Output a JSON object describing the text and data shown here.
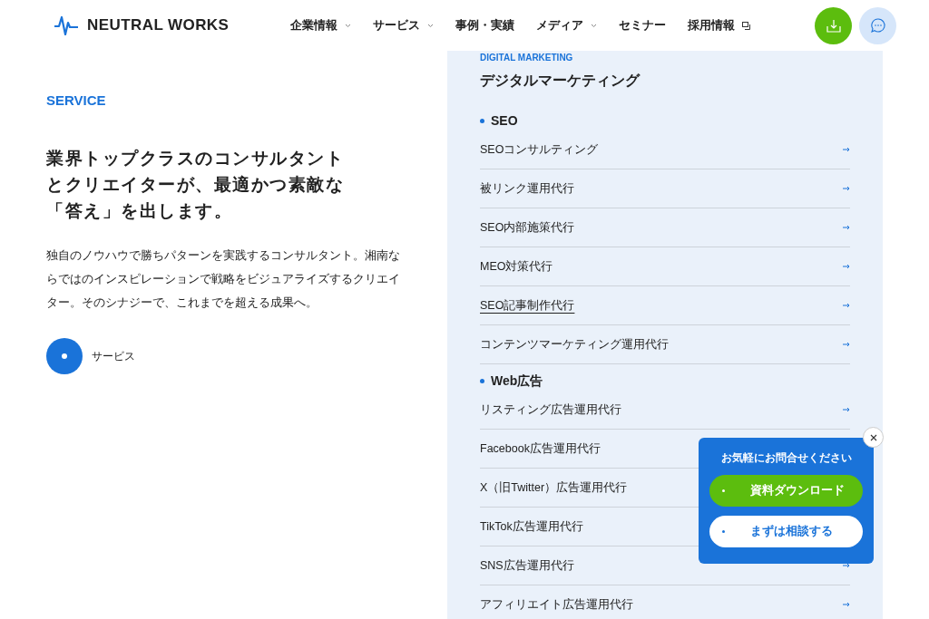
{
  "header": {
    "logo": "NEUTRAL WORKS",
    "nav": [
      {
        "label": "企業情報",
        "kind": "dropdown"
      },
      {
        "label": "サービス",
        "kind": "dropdown"
      },
      {
        "label": "事例・実績",
        "kind": "link"
      },
      {
        "label": "メディア",
        "kind": "dropdown"
      },
      {
        "label": "セミナー",
        "kind": "link"
      },
      {
        "label": "採用情報",
        "kind": "external"
      }
    ]
  },
  "intro": {
    "eyebrow": "SERVICE",
    "heading": [
      "業界トップクラスのコンサルタント",
      "とクリエイターが、最適かつ素敵な",
      "「答え」を出します。"
    ],
    "body": "独自のノウハウで勝ちパターンを実践するコンサルタント。湘南ならではのインスピレーションで戦略をビジュアライズするクリエイター。そのシナジーで、これまでを超える成果へ。",
    "link": "サービス"
  },
  "panel": {
    "eyebrow": "DIGITAL MARKETING",
    "title": "デジタルマーケティング",
    "groups": [
      {
        "title": "SEO",
        "items": [
          {
            "label": "SEOコンサルティング",
            "hovered": false
          },
          {
            "label": "被リンク運用代行",
            "hovered": false
          },
          {
            "label": "SEO内部施策代行",
            "hovered": false
          },
          {
            "label": "MEO対策代行",
            "hovered": false
          },
          {
            "label": "SEO記事制作代行",
            "hovered": true
          },
          {
            "label": "コンテンツマーケティング運用代行",
            "hovered": false
          }
        ]
      },
      {
        "title": "Web広告",
        "items": [
          {
            "label": "リスティング広告運用代行",
            "hovered": false
          },
          {
            "label": "Facebook広告運用代行",
            "hovered": false
          },
          {
            "label": "X（旧Twitter）広告運用代行",
            "hovered": false
          },
          {
            "label": "TikTok広告運用代行",
            "hovered": false
          },
          {
            "label": "SNS広告運用代行",
            "hovered": false
          },
          {
            "label": "アフィリエイト広告運用代行",
            "hovered": false
          }
        ]
      }
    ]
  },
  "popup": {
    "title": "お気軽にお問合せください",
    "buttons": [
      {
        "label": "資料ダウンロード",
        "kind": "primary"
      },
      {
        "label": "まずは相談する",
        "kind": "secondary"
      }
    ]
  }
}
